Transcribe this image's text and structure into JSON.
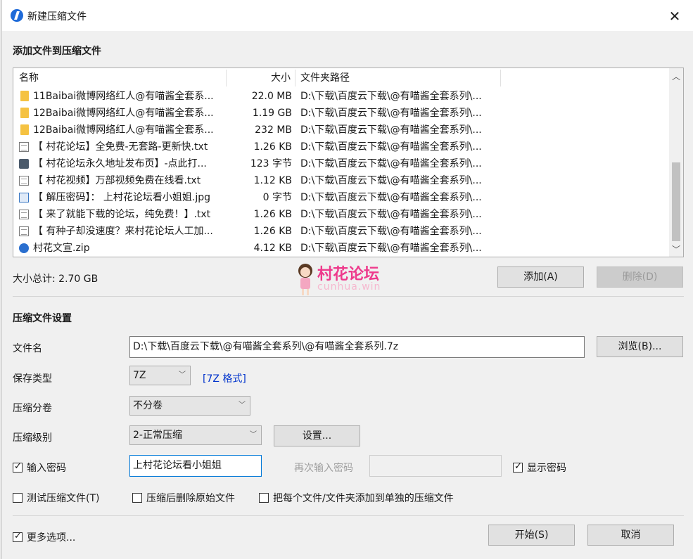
{
  "window": {
    "title": "新建压缩文件"
  },
  "add_section": {
    "title": "添加文件到压缩文件"
  },
  "file_list": {
    "columns": {
      "name": "名称",
      "size": "大小",
      "path": "文件夹路径"
    },
    "rows": [
      {
        "icon": "folder-icon",
        "name": "11Baibai微博网络红人@有喵酱全套系...",
        "size": "22.0 MB",
        "path": "D:\\下载\\百度云下载\\@有喵酱全套系列\\..."
      },
      {
        "icon": "folder-icon",
        "name": "12Baibai微博网络红人@有喵酱全套系...",
        "size": "1.19 GB",
        "path": "D:\\下载\\百度云下载\\@有喵酱全套系列\\..."
      },
      {
        "icon": "folder-icon",
        "name": "12Baibai微博网络红人@有喵酱全套系...",
        "size": "232 MB",
        "path": "D:\\下载\\百度云下载\\@有喵酱全套系列\\..."
      },
      {
        "icon": "text-file-icon",
        "name": "【 村花论坛】全免费-无套路-更新快.txt",
        "size": "1.26 KB",
        "path": "D:\\下载\\百度云下载\\@有喵酱全套系列\\..."
      },
      {
        "icon": "url-file-icon",
        "name": "【 村花论坛永久地址发布页】-点此打...",
        "size": "123 字节",
        "path": "D:\\下载\\百度云下载\\@有喵酱全套系列\\..."
      },
      {
        "icon": "text-file-icon",
        "name": "【 村花视频】万部视频免费在线看.txt",
        "size": "1.12 KB",
        "path": "D:\\下载\\百度云下载\\@有喵酱全套系列\\..."
      },
      {
        "icon": "image-file-icon",
        "name": "【 解压密码】： 上村花论坛看小姐姐.jpg",
        "size": "0 字节",
        "path": "D:\\下载\\百度云下载\\@有喵酱全套系列\\..."
      },
      {
        "icon": "text-file-icon",
        "name": "【 来了就能下载的论坛，纯免费！】.txt",
        "size": "1.26 KB",
        "path": "D:\\下载\\百度云下载\\@有喵酱全套系列\\..."
      },
      {
        "icon": "text-file-icon",
        "name": "【 有种子却没速度？来村花论坛人工加...",
        "size": "1.26 KB",
        "path": "D:\\下载\\百度云下载\\@有喵酱全套系列\\..."
      },
      {
        "icon": "zip-file-icon",
        "name": "村花文宣.zip",
        "size": "4.12 KB",
        "path": "D:\\下载\\百度云下载\\@有喵酱全套系列\\..."
      }
    ]
  },
  "summary": {
    "total_size": "大小总计: 2.70 GB"
  },
  "buttons": {
    "add": "添加(A)",
    "delete": "删除(D)",
    "browse": "浏览(B)...",
    "settings": "设置...",
    "start": "开始(S)",
    "cancel": "取消"
  },
  "settings_section": {
    "title": "压缩文件设置"
  },
  "form": {
    "filename_label": "文件名",
    "filename_value": "D:\\下载\\百度云下载\\@有喵酱全套系列\\@有喵酱全套系列.7z",
    "save_type_label": "保存类型",
    "save_type_value": "7Z",
    "format_link": "[7Z 格式]",
    "split_label": "压缩分卷",
    "split_value": "不分卷",
    "level_label": "压缩级别",
    "level_value": "2-正常压缩",
    "password_label": "输入密码",
    "password_value": "上村花论坛看小姐姐",
    "password_repeat_label": "再次输入密码",
    "show_password_label": "显示密码",
    "test_archive_label": "测试压缩文件(T)",
    "delete_after_label": "压缩后删除原始文件",
    "separate_archives_label": "把每个文件/文件夹添加到单独的压缩文件",
    "more_options_label": "更多选项..."
  },
  "checks": {
    "password": true,
    "show_password": true,
    "test_archive": false,
    "delete_after": false,
    "separate_archives": false,
    "more_options": true
  },
  "watermark": {
    "title": "村花论坛",
    "subtitle": "cunhua.win"
  }
}
